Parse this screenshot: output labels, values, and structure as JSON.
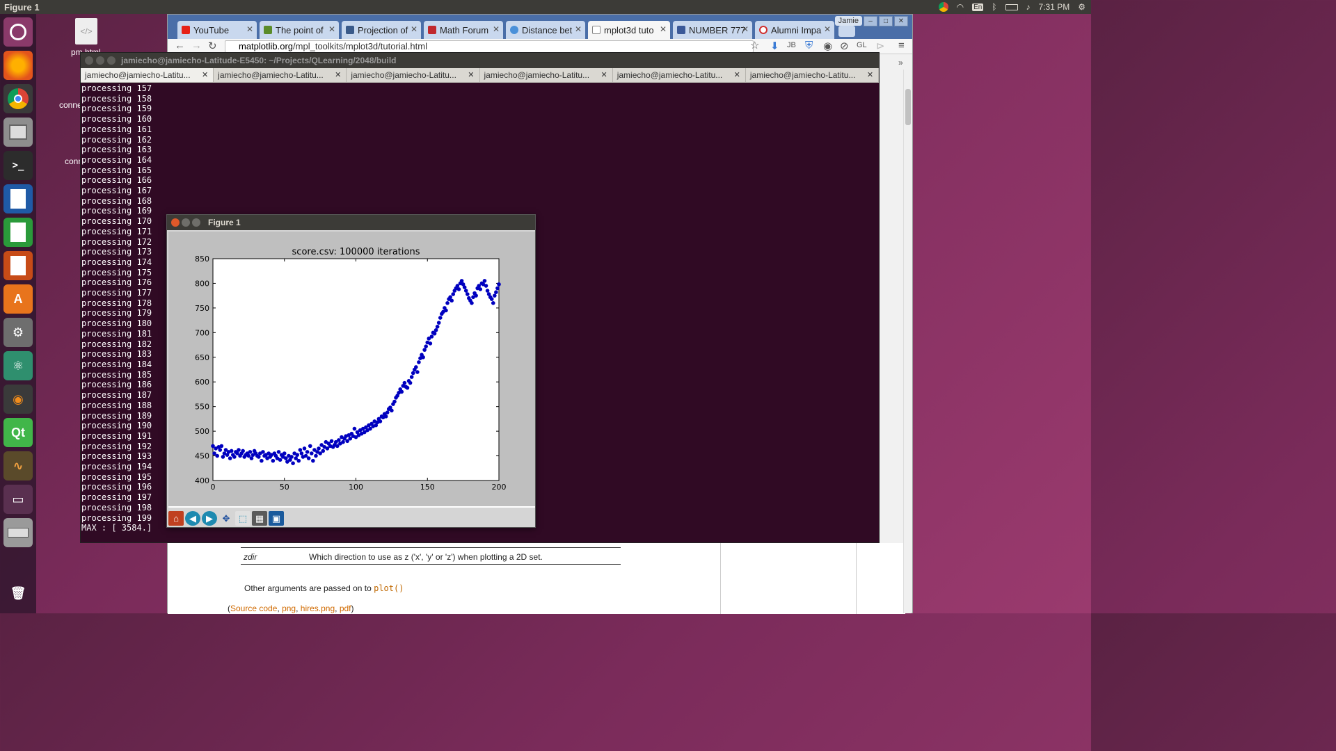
{
  "topbar": {
    "title": "Figure 1",
    "lang": "En",
    "time": "7:31 PM"
  },
  "desktop": {
    "icon1_label": "pm.html",
    "icon2_label": "conne",
    "icon3_label": "conn"
  },
  "browser": {
    "tabs": [
      {
        "label": "YouTube",
        "color": "#e62117"
      },
      {
        "label": "The point of",
        "color": "#5b8c2a"
      },
      {
        "label": "Projection of",
        "color": "#3a5a8a"
      },
      {
        "label": "Math Forum",
        "color": "#c0282d"
      },
      {
        "label": "Distance bet",
        "color": "#4a90d9"
      },
      {
        "label": "mplot3d tuto",
        "color": "#888888"
      },
      {
        "label": "NUMBER 777",
        "color": "#3b5998"
      },
      {
        "label": "Alumni Impa",
        "color": "#d03030"
      }
    ],
    "profile": "Jamie",
    "url_host": "matplotlib.org",
    "url_path": "/mpl_toolkits/mplot3d/tutorial.html",
    "page": {
      "row_key": "zdir",
      "row_value": "Which direction to use as z ('x', 'y' or 'z') when plotting a 2D set.",
      "para_text": "Other arguments are passed on to ",
      "para_code": "plot()",
      "links_open": "(",
      "link1": "Source code",
      "link2": "png",
      "link3": "hires.png",
      "link4": "pdf",
      "links_close": ")"
    }
  },
  "terminal": {
    "title": "jamiecho@jamiecho-Latitude-E5450: ~/Projects/QLearning/2048/build",
    "tab_label": "jamiecho@jamiecho-Latitu...",
    "lines": [
      "processing 157",
      "processing 158",
      "processing 159",
      "processing 160",
      "processing 161",
      "processing 162",
      "processing 163",
      "processing 164",
      "processing 165",
      "processing 166",
      "processing 167",
      "processing 168",
      "processing 169",
      "processing 170",
      "processing 171",
      "processing 172",
      "processing 173",
      "processing 174",
      "processing 175",
      "processing 176",
      "processing 177",
      "processing 178",
      "processing 179",
      "processing 180",
      "processing 181",
      "processing 182",
      "processing 183",
      "processing 184",
      "processing 185",
      "processing 186",
      "processing 187",
      "processing 188",
      "processing 189",
      "processing 190",
      "processing 191",
      "processing 192",
      "processing 193",
      "processing 194",
      "processing 195",
      "processing 196",
      "processing 197",
      "processing 198",
      "processing 199",
      "MAX : [ 3584.]"
    ]
  },
  "figure": {
    "window_title": "Figure 1"
  },
  "chart_data": {
    "type": "scatter",
    "title": "score.csv: 100000 iterations",
    "xlabel": "",
    "ylabel": "",
    "xlim": [
      0,
      200
    ],
    "ylim": [
      400,
      850
    ],
    "xticks": [
      0,
      50,
      100,
      150,
      200
    ],
    "yticks": [
      400,
      450,
      500,
      550,
      600,
      650,
      700,
      750,
      800,
      850
    ],
    "marker_color": "#0000bf",
    "x": [
      0,
      1,
      2,
      3,
      4,
      5,
      6,
      7,
      8,
      9,
      10,
      11,
      12,
      13,
      14,
      15,
      16,
      17,
      18,
      19,
      20,
      21,
      22,
      23,
      24,
      25,
      26,
      27,
      28,
      29,
      30,
      31,
      32,
      33,
      34,
      35,
      36,
      37,
      38,
      39,
      40,
      41,
      42,
      43,
      44,
      45,
      46,
      47,
      48,
      49,
      50,
      51,
      52,
      53,
      54,
      55,
      56,
      57,
      58,
      59,
      60,
      61,
      62,
      63,
      64,
      65,
      66,
      67,
      68,
      69,
      70,
      71,
      72,
      73,
      74,
      75,
      76,
      77,
      78,
      79,
      80,
      81,
      82,
      83,
      84,
      85,
      86,
      87,
      88,
      89,
      90,
      91,
      92,
      93,
      94,
      95,
      96,
      97,
      98,
      99,
      100,
      101,
      102,
      103,
      104,
      105,
      106,
      107,
      108,
      109,
      110,
      111,
      112,
      113,
      114,
      115,
      116,
      117,
      118,
      119,
      120,
      121,
      122,
      123,
      124,
      125,
      126,
      127,
      128,
      129,
      130,
      131,
      132,
      133,
      134,
      135,
      136,
      137,
      138,
      139,
      140,
      141,
      142,
      143,
      144,
      145,
      146,
      147,
      148,
      149,
      150,
      151,
      152,
      153,
      154,
      155,
      156,
      157,
      158,
      159,
      160,
      161,
      162,
      163,
      164,
      165,
      166,
      167,
      168,
      169,
      170,
      171,
      172,
      173,
      174,
      175,
      176,
      177,
      178,
      179,
      180,
      181,
      182,
      183,
      184,
      185,
      186,
      187,
      188,
      189,
      190,
      191,
      192,
      193,
      194,
      195,
      196,
      197,
      198,
      199,
      200
    ],
    "y": [
      470,
      455,
      465,
      450,
      468,
      462,
      470,
      448,
      455,
      462,
      452,
      458,
      445,
      460,
      452,
      448,
      458,
      455,
      462,
      450,
      455,
      460,
      448,
      452,
      455,
      450,
      458,
      445,
      452,
      460,
      455,
      450,
      448,
      455,
      440,
      458,
      450,
      452,
      445,
      455,
      448,
      452,
      440,
      455,
      450,
      445,
      458,
      442,
      452,
      448,
      455,
      445,
      438,
      450,
      442,
      448,
      435,
      455,
      445,
      452,
      440,
      462,
      455,
      448,
      465,
      450,
      458,
      445,
      470,
      455,
      440,
      462,
      450,
      458,
      465,
      455,
      472,
      460,
      468,
      478,
      465,
      475,
      470,
      480,
      468,
      472,
      478,
      470,
      482,
      475,
      488,
      478,
      485,
      490,
      480,
      492,
      485,
      495,
      490,
      505,
      488,
      498,
      492,
      502,
      495,
      505,
      498,
      508,
      502,
      512,
      505,
      515,
      510,
      520,
      512,
      518,
      525,
      520,
      530,
      528,
      535,
      530,
      538,
      545,
      548,
      542,
      555,
      560,
      568,
      572,
      578,
      585,
      580,
      592,
      598,
      590,
      588,
      602,
      598,
      610,
      618,
      625,
      630,
      620,
      640,
      648,
      655,
      650,
      665,
      672,
      680,
      688,
      678,
      692,
      700,
      698,
      705,
      712,
      720,
      730,
      738,
      742,
      750,
      745,
      760,
      768,
      772,
      765,
      778,
      785,
      790,
      795,
      788,
      800,
      805,
      798,
      792,
      785,
      778,
      770,
      765,
      760,
      772,
      780,
      775,
      790,
      795,
      788,
      800,
      798,
      805,
      795,
      785,
      778,
      772,
      768,
      760,
      775,
      782,
      790,
      798
    ]
  }
}
